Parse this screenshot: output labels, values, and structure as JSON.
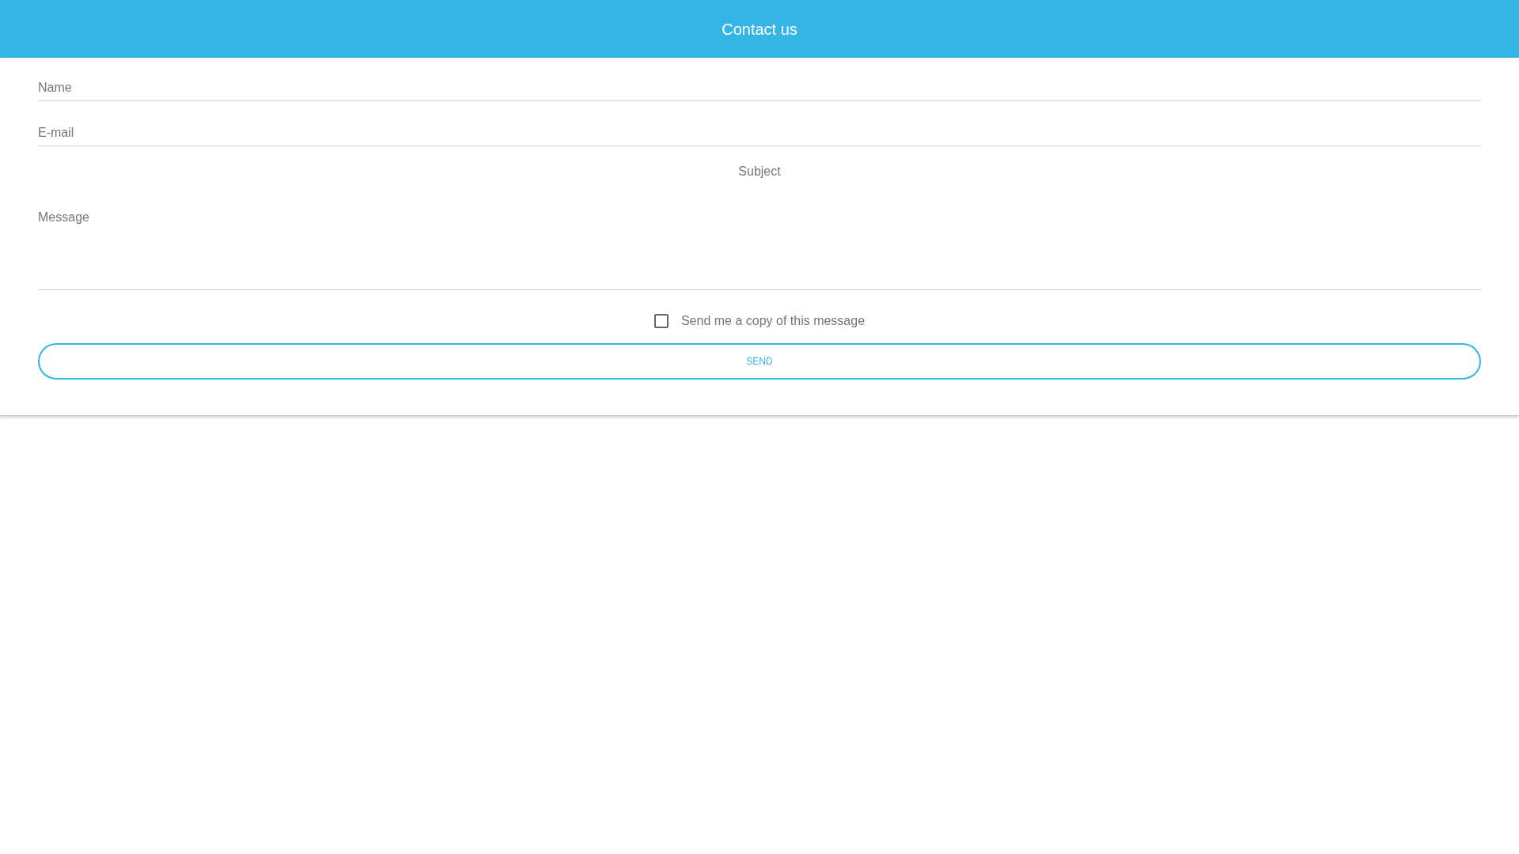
{
  "header": {
    "title": "Contact us"
  },
  "form": {
    "name": {
      "placeholder": "Name"
    },
    "email": {
      "placeholder": "E-mail"
    },
    "subject": {
      "label": "Subject"
    },
    "message": {
      "placeholder": "Message"
    },
    "copy": {
      "label": "Send me a copy of this message",
      "checked": false
    },
    "submit": {
      "label": "SEND"
    }
  }
}
